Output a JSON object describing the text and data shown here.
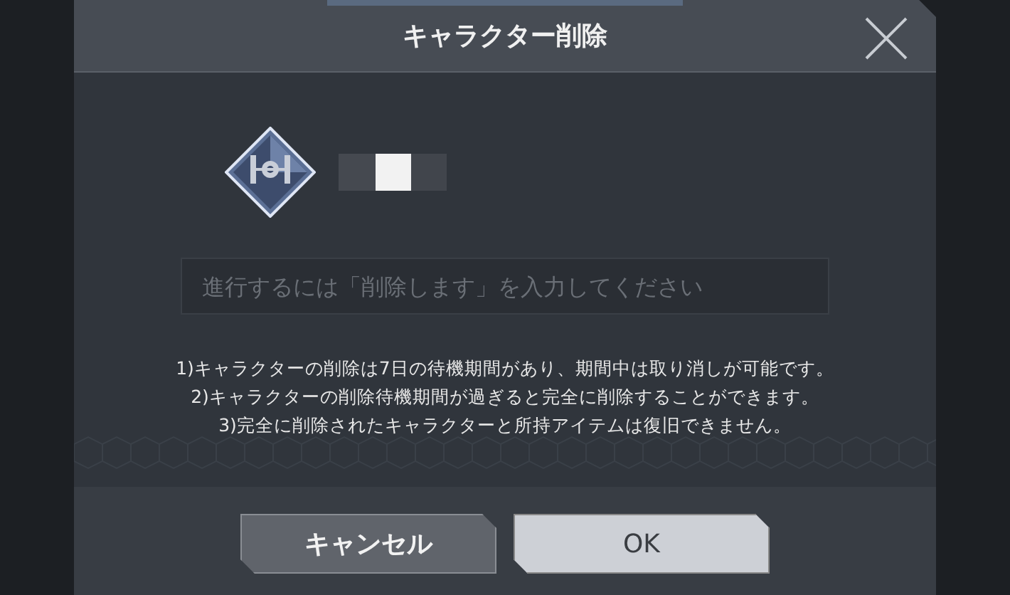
{
  "dialog": {
    "title": "キャラクター削除"
  },
  "confirm_field": {
    "placeholder": "進行するには「削除します」を入力してください"
  },
  "notes": [
    "1)キャラクターの削除は7日の待機期間があり、期間中は取り消しが可能です。",
    "2)キャラクターの削除待機期間が過ぎると完全に削除することができます。",
    "3)完全に削除されたキャラクターと所持アイテムは復旧できません。"
  ],
  "buttons": [
    {
      "label": "キャンセル",
      "kind": "secondary"
    },
    {
      "label": "OK",
      "kind": "primary"
    }
  ]
}
